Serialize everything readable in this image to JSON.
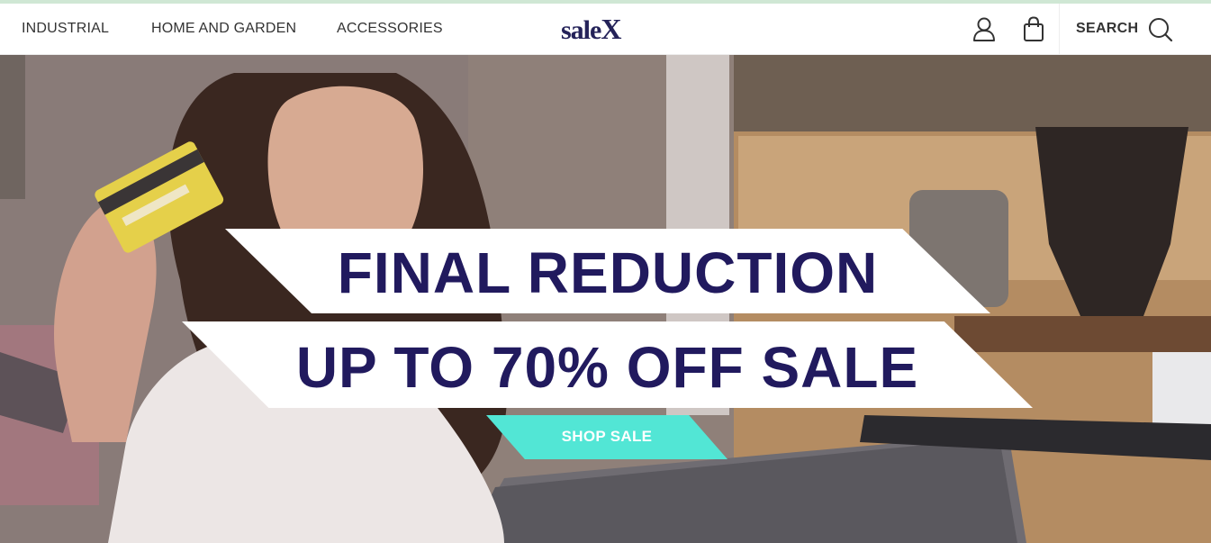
{
  "nav": {
    "items": [
      {
        "label": "INDUSTRIAL"
      },
      {
        "label": "HOME AND GARDEN"
      },
      {
        "label": "ACCESSORIES"
      }
    ]
  },
  "brand": {
    "logo_main": "sale",
    "logo_accent": "X"
  },
  "header_actions": {
    "account_icon": "user-icon",
    "cart_icon": "shopping-bag-icon",
    "search_label": "SEARCH",
    "search_icon": "search-icon"
  },
  "hero": {
    "headline": "FINAL REDUCTION",
    "subheadline": "UP TO 70% OFF SALE",
    "cta_label": "SHOP SALE"
  },
  "colors": {
    "brand_navy": "#211a5e",
    "cta_teal": "#52e6d5",
    "top_line": "#cfe7d4"
  }
}
